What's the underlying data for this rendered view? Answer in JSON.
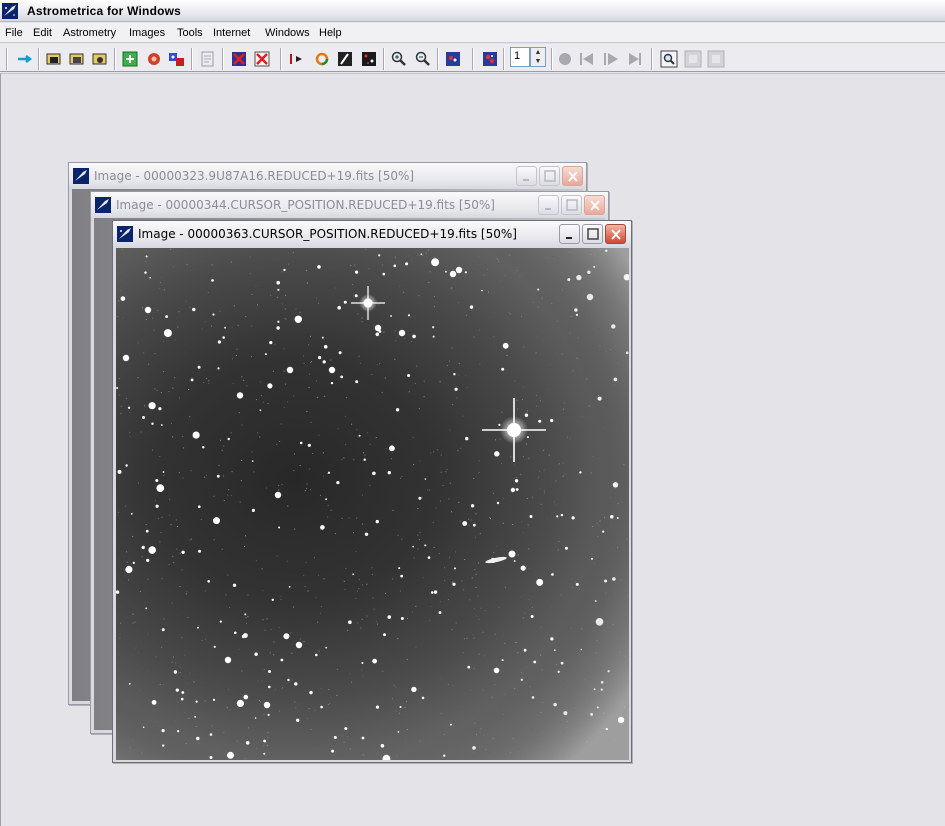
{
  "app": {
    "title": "Astrometrica for Windows",
    "accent_color": "#0a246a"
  },
  "menu": {
    "items": [
      "File",
      "Edit",
      "Astrometry",
      "Images",
      "Tools",
      "Internet",
      "Windows",
      "Help"
    ]
  },
  "toolbar": {
    "buttons": [
      "arrow-right-icon",
      "open-images-icon",
      "open-icon",
      "open-alt-icon",
      "data-reduction-icon",
      "settings-gear-icon",
      "blink-icon",
      "properties-icon",
      "remove-icon",
      "close-all-icon",
      "mark-icon",
      "circle-icon",
      "contrast-icon",
      "colorize-icon",
      "zoom-in-icon",
      "zoom-out-icon",
      "star-catalog-icon",
      "track-icon",
      "record-icon",
      "step-back-icon",
      "play-icon",
      "step-forward-icon",
      "search-icon",
      "grey-button-1-icon",
      "grey-button-2-icon"
    ],
    "frame_value": "1"
  },
  "windows": [
    {
      "title": "Image - 00000323.9U87A16.REDUCED+19.fits [50%]",
      "active": false
    },
    {
      "title": "Image - 00000344.CURSOR_POSITION.REDUCED+19.fits [50%]",
      "active": false
    },
    {
      "title": "Image - 00000363.CURSOR_POSITION.REDUCED+19.fits [50%]",
      "active": true
    }
  ]
}
